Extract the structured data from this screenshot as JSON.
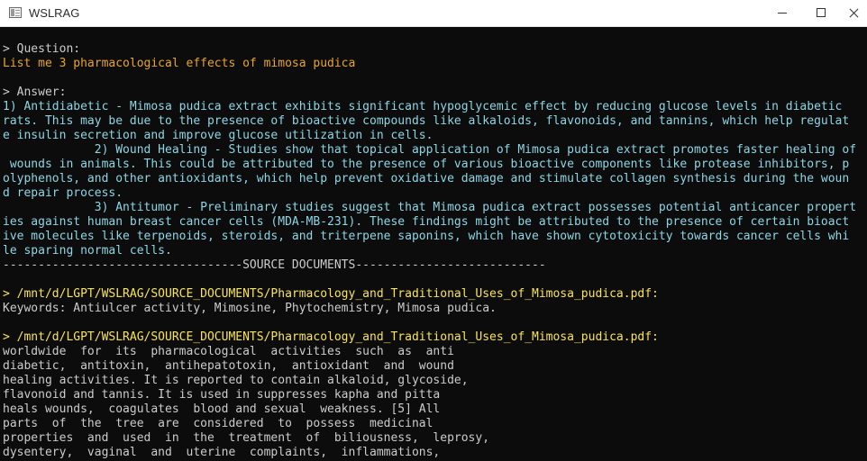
{
  "window": {
    "title": "WSLRAG"
  },
  "terminal": {
    "question_label": "> Question:",
    "question_text": "List me 3 pharmacological effects of mimosa pudica",
    "answer_label": "> Answer:",
    "answer_lines": [
      "1) Antidiabetic - Mimosa pudica extract exhibits significant hypoglycemic effect by reducing glucose levels in diabetic",
      "rats. This may be due to the presence of bioactive compounds like alkaloids, flavonoids, and tannins, which help regulat",
      "e insulin secretion and improve glucose utilization in cells.",
      "             2) Wound Healing - Studies show that topical application of Mimosa pudica extract promotes faster healing of",
      " wounds in animals. This could be attributed to the presence of various bioactive components like protease inhibitors, p",
      "olyphenols, and other antioxidants, which help prevent oxidative damage and stimulate collagen synthesis during the woun",
      "d repair process.",
      "             3) Antitumor - Preliminary studies suggest that Mimosa pudica extract possesses potential anticancer propert",
      "ies against human breast cancer cells (MDA-MB-231). These findings might be attributed to the presence of certain bioact",
      "ive molecules like terpenoids, steroids, and triterpene saponins, which have shown cytotoxicity towards cancer cells whi",
      "le sparing normal cells."
    ],
    "separator": "----------------------------------SOURCE DOCUMENTS---------------------------",
    "sources": [
      {
        "path": "> /mnt/d/LGPT/WSLRAG/SOURCE_DOCUMENTS/Pharmacology_and_Traditional_Uses_of_Mimosa_pudica.pdf:",
        "lines": [
          "Keywords: Antiulcer activity, Mimosine, Phytochemistry, Mimosa pudica."
        ]
      },
      {
        "path": "> /mnt/d/LGPT/WSLRAG/SOURCE_DOCUMENTS/Pharmacology_and_Traditional_Uses_of_Mimosa_pudica.pdf:",
        "lines": [
          "worldwide  for  its  pharmacological  activities  such  as  anti",
          "diabetic,  antitoxin,  antihepatotoxin,  antioxidant  and  wound",
          "healing activities. It is reported to contain alkaloid, glycoside,",
          "flavonoid and tannis. It is used in suppresses kapha and pitta",
          "heals wounds,  coagulates  blood and sexual  weakness. [5] All",
          "parts  of  the  tree  are  considered  to  possess  medicinal",
          "properties  and  used  in  the  treatment  of  biliousness,  leprosy,",
          "dysentery,  vaginal  and  uterine  complaints,  inflammations,"
        ]
      }
    ]
  },
  "colors": {
    "background": "#0c0c0c",
    "text": "#cccccc",
    "question": "#e8a52b",
    "answer": "#8dd6e6",
    "source_path": "#f9e35b"
  },
  "icons": {
    "app": "terminal-window-icon",
    "minimize": "minimize-icon",
    "maximize": "maximize-icon",
    "close": "close-icon"
  }
}
